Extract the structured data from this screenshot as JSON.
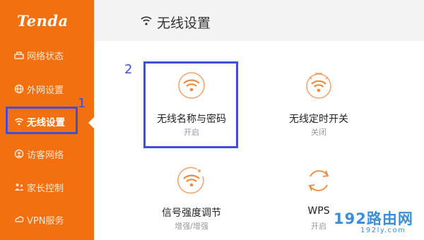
{
  "brand": {
    "logo": "Tenda"
  },
  "sidebar": {
    "items": [
      {
        "label": "网络状态",
        "icon": "network-status-icon"
      },
      {
        "label": "外网设置",
        "icon": "globe-icon"
      },
      {
        "label": "无线设置",
        "icon": "wifi-icon",
        "active": true
      },
      {
        "label": "访客网络",
        "icon": "guest-network-icon"
      },
      {
        "label": "家长控制",
        "icon": "parental-control-icon"
      },
      {
        "label": "VPN服务",
        "icon": "vpn-icon"
      }
    ]
  },
  "header": {
    "title": "无线设置",
    "icon": "wifi-icon"
  },
  "tiles": [
    {
      "name": "无线名称与密码",
      "sub": "开启",
      "icon": "wifi-circle-icon"
    },
    {
      "name": "无线定时开关",
      "sub": "关闭",
      "icon": "wifi-timer-icon"
    },
    {
      "name": "信号强度调节",
      "sub": "增强/增强",
      "icon": "wifi-signal-strength-icon"
    },
    {
      "name": "WPS",
      "sub": "开启",
      "icon": "wps-refresh-icon"
    }
  ],
  "annotations": {
    "step1": "1",
    "step2": "2"
  },
  "watermark": {
    "big": "192路由网",
    "small": "192ly.com"
  },
  "colors": {
    "sidebar": "#f2700f",
    "accent": "#f08a3e",
    "annotation": "#3e4fd8",
    "watermark": "#3a8fd8"
  }
}
